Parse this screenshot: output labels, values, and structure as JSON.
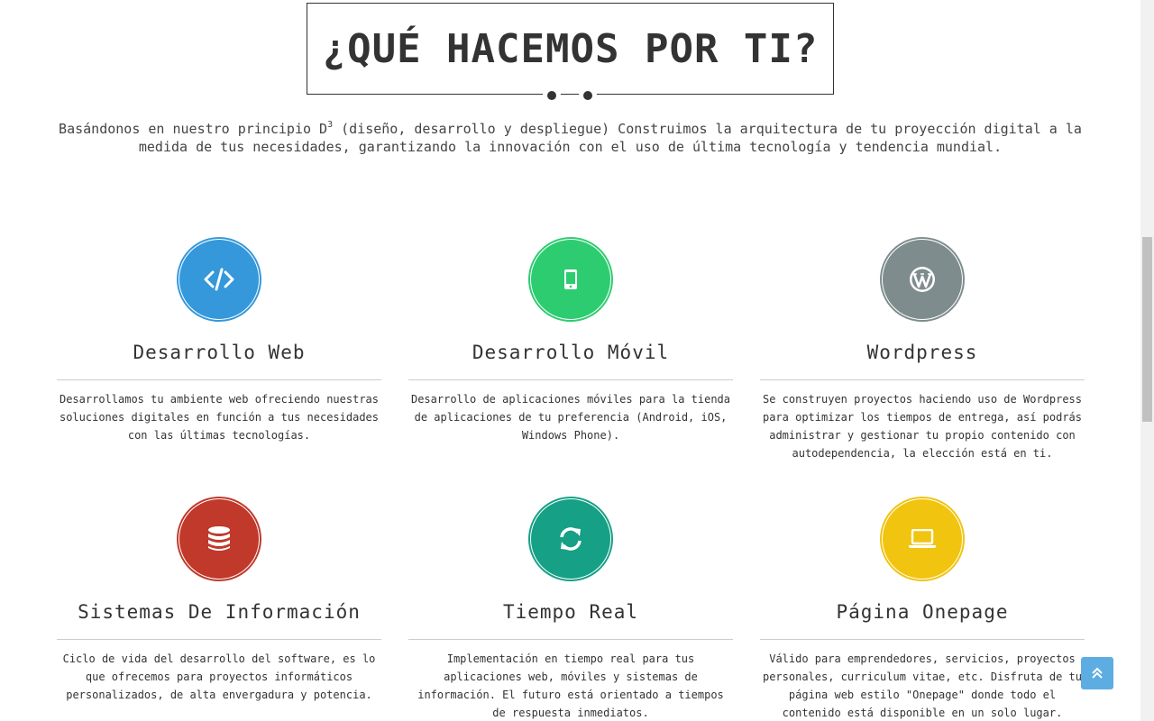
{
  "section": {
    "title": "¿QUÉ HACEMOS POR TI?",
    "intro_before": "Basándonos en nuestro principio D",
    "intro_sup": "3",
    "intro_after": " (diseño, desarrollo y despliegue) Construimos la arquitectura de tu proyección digital a la medida de tus necesidades, garantizando la innovación con el uso de última tecnología y tendencia mundial."
  },
  "services": [
    {
      "title": "Desarrollo Web",
      "description": "Desarrollamos tu ambiente web ofreciendo nuestras soluciones digitales en función a tus necesidades con las últimas tecnologías.",
      "icon": "code-icon",
      "color": "#3498db"
    },
    {
      "title": "Desarrollo Móvil",
      "description": "Desarrollo de aplicaciones móviles para la tienda de aplicaciones de tu preferencia (Android, iOS, Windows Phone).",
      "icon": "mobile-icon",
      "color": "#2ecc71"
    },
    {
      "title": "Wordpress",
      "description": "Se construyen proyectos haciendo uso de Wordpress para optimizar los tiempos de entrega, así podrás administrar y gestionar tu propio contenido con autodependencia, la elección está en ti.",
      "icon": "wordpress-icon",
      "color": "#7f8c8d"
    },
    {
      "title": "Sistemas De Información",
      "description": "Ciclo de vida del desarrollo del software, es lo que ofrecemos para proyectos informáticos personalizados, de alta envergadura y potencia.",
      "icon": "database-icon",
      "color": "#c0392b"
    },
    {
      "title": "Tiempo Real",
      "description": "Implementación en tiempo real para tus aplicaciones web, móviles y sistemas de información. El futuro está orientado a tiempos de respuesta inmediatos.",
      "icon": "refresh-icon",
      "color": "#16a085"
    },
    {
      "title": "Página Onepage",
      "description": "Válido para emprendedores, servicios, proyectos personales, curriculum vitae, etc. Disfruta de tu página web estilo \"Onepage\" donde todo el contenido está disponible en un solo lugar.",
      "icon": "laptop-icon",
      "color": "#f1c40f"
    }
  ],
  "back_to_top": {
    "icon": "double-chevron-up-icon",
    "color": "#5dade2"
  }
}
